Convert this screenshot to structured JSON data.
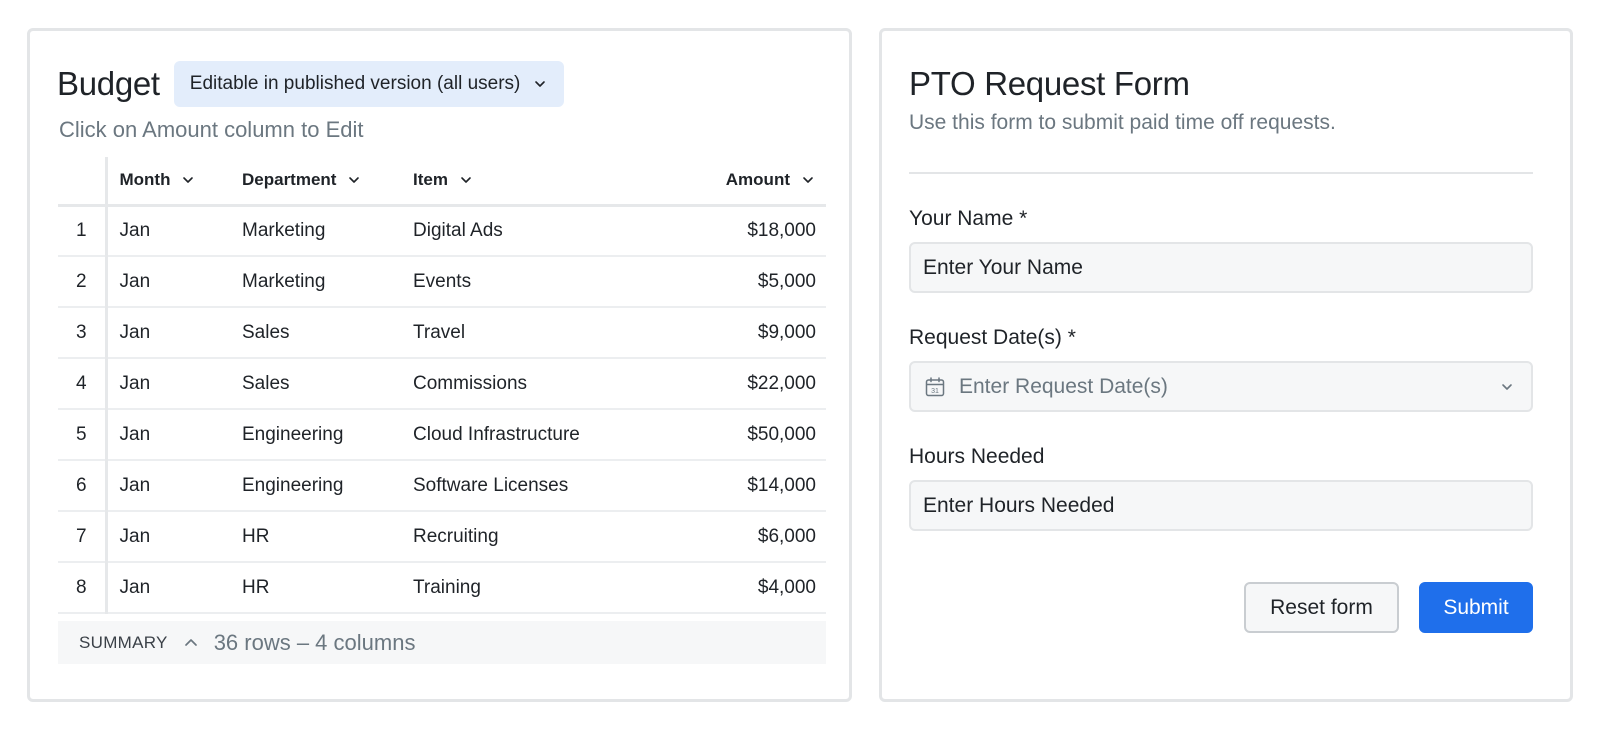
{
  "budget": {
    "title": "Budget",
    "edit_badge": "Editable in published version (all users)",
    "subtitle": "Click on Amount column to Edit",
    "columns": [
      "Month",
      "Department",
      "Item",
      "Amount"
    ],
    "rows": [
      {
        "idx": "1",
        "month": "Jan",
        "department": "Marketing",
        "item": "Digital Ads",
        "amount": "$18,000"
      },
      {
        "idx": "2",
        "month": "Jan",
        "department": "Marketing",
        "item": "Events",
        "amount": "$5,000"
      },
      {
        "idx": "3",
        "month": "Jan",
        "department": "Sales",
        "item": "Travel",
        "amount": "$9,000"
      },
      {
        "idx": "4",
        "month": "Jan",
        "department": "Sales",
        "item": "Commissions",
        "amount": "$22,000"
      },
      {
        "idx": "5",
        "month": "Jan",
        "department": "Engineering",
        "item": "Cloud Infrastructure",
        "amount": "$50,000"
      },
      {
        "idx": "6",
        "month": "Jan",
        "department": "Engineering",
        "item": "Software Licenses",
        "amount": "$14,000"
      },
      {
        "idx": "7",
        "month": "Jan",
        "department": "HR",
        "item": "Recruiting",
        "amount": "$6,000"
      },
      {
        "idx": "8",
        "month": "Jan",
        "department": "HR",
        "item": "Training",
        "amount": "$4,000"
      }
    ],
    "summary": {
      "label": "SUMMARY",
      "info": "36 rows – 4 columns"
    }
  },
  "pto": {
    "title": "PTO Request Form",
    "subtitle": "Use this form to submit paid time off requests.",
    "fields": {
      "name": {
        "label": "Your Name *",
        "value": "Enter Your Name"
      },
      "dates": {
        "label": "Request Date(s) *",
        "placeholder": "Enter Request Date(s)"
      },
      "hours": {
        "label": "Hours Needed",
        "value": "Enter Hours Needed"
      }
    },
    "buttons": {
      "reset": "Reset form",
      "submit": "Submit"
    }
  },
  "colors": {
    "accent": "#1f6feb",
    "badge_bg": "#e3edfb",
    "muted_text": "#6b7780",
    "border": "#e3e5e7"
  },
  "icons": [
    "chevron-down-icon",
    "chevron-up-icon",
    "calendar-icon"
  ]
}
